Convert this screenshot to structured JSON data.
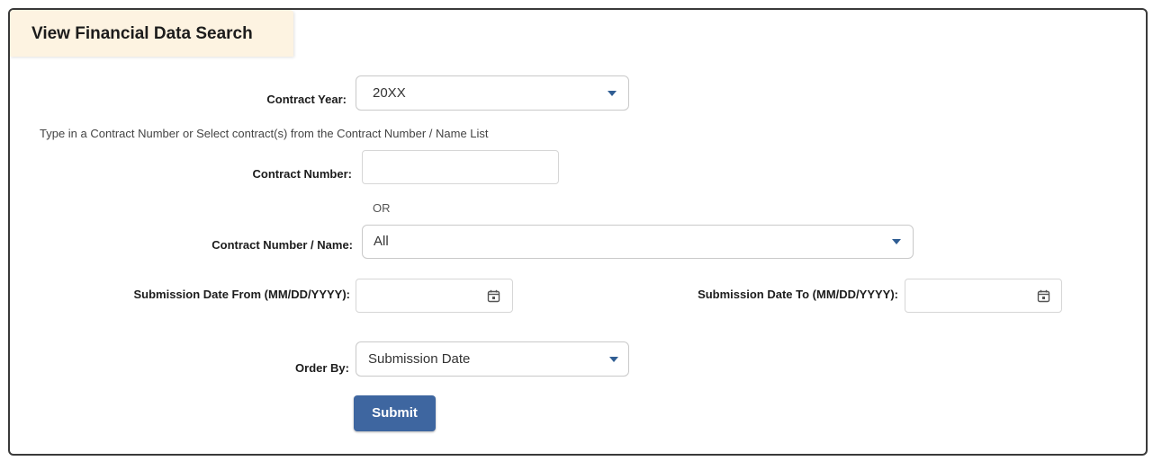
{
  "page_title": "View Financial Data Search",
  "contract_year": {
    "label": "Contract Year:",
    "value": "20XX"
  },
  "hint_text": "Type in a Contract Number or Select contract(s) from the Contract Number / Name List",
  "contract_number": {
    "label": "Contract Number:",
    "value": ""
  },
  "or_text": "OR",
  "contract_number_name": {
    "label": "Contract Number / Name:",
    "value": "All"
  },
  "date_from": {
    "label": "Submission Date From (MM/DD/YYYY):",
    "value": ""
  },
  "date_to": {
    "label": "Submission Date To (MM/DD/YYYY):",
    "value": ""
  },
  "order_by": {
    "label": "Order By:",
    "value": "Submission Date"
  },
  "submit_label": "Submit",
  "colors": {
    "accent": "#3e66a0",
    "title_bg": "#fdf3e1",
    "caret": "#2f5d93"
  }
}
